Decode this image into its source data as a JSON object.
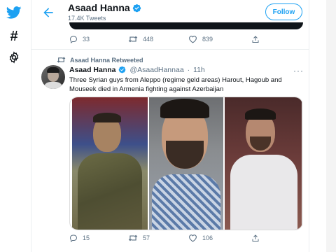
{
  "nav": {
    "items": [
      {
        "icon": "twitter-bird-icon"
      },
      {
        "icon": "hashtag-icon",
        "glyph": "#"
      },
      {
        "icon": "gear-icon"
      }
    ]
  },
  "header": {
    "name": "Asaad Hanna",
    "tweet_count": "17.4K Tweets",
    "follow_label": "Follow"
  },
  "previous_tweet": {
    "replies": "33",
    "retweets": "448",
    "likes": "839"
  },
  "retweet_context": "Asaad Hanna Retweeted",
  "tweet": {
    "name": "Asaad Hanna",
    "handle": "@AsaadHannaa",
    "dot": "·",
    "time": "11h",
    "more": "···",
    "text": "Three Syrian guys from Aleppo (regime geld areas) Harout, Hagoub and Mouseek died in Armenia fighting against Azerbaijan",
    "replies": "15",
    "retweets": "57",
    "likes": "106"
  },
  "colors": {
    "brand": "#1da1f2",
    "muted": "#5b7083",
    "text": "#0f1419"
  }
}
